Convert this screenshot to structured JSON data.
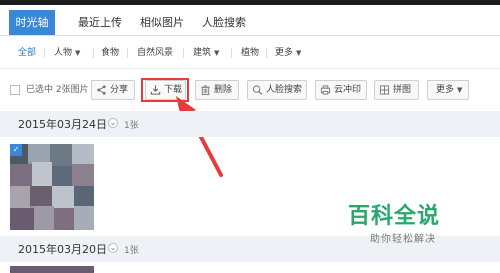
{
  "tabs": [
    {
      "label": "时光轴",
      "active": true
    },
    {
      "label": "最近上传"
    },
    {
      "label": "相似图片"
    },
    {
      "label": "人脸搜索"
    }
  ],
  "filters": {
    "all": "全部",
    "people": "人物",
    "food": "食物",
    "scenery": "自然风景",
    "building": "建筑",
    "plant": "植物",
    "more": "更多"
  },
  "toolbar": {
    "selected_label": "已选中 2张图片",
    "share": "分享",
    "download": "下载",
    "delete": "删除",
    "face_search": "人脸搜索",
    "cloud_print": "云冲印",
    "puzzle": "拼图",
    "more": "更多"
  },
  "groups": [
    {
      "date": "2015年03月24日",
      "count": "1张"
    },
    {
      "date": "2015年03月20日",
      "count": "1张"
    }
  ],
  "watermark": {
    "title": "百科全说",
    "subtitle": "助你轻松解决"
  },
  "colors": {
    "accent": "#3a87d8",
    "highlight": "#e53b3b",
    "watermark": "#29a86d"
  }
}
